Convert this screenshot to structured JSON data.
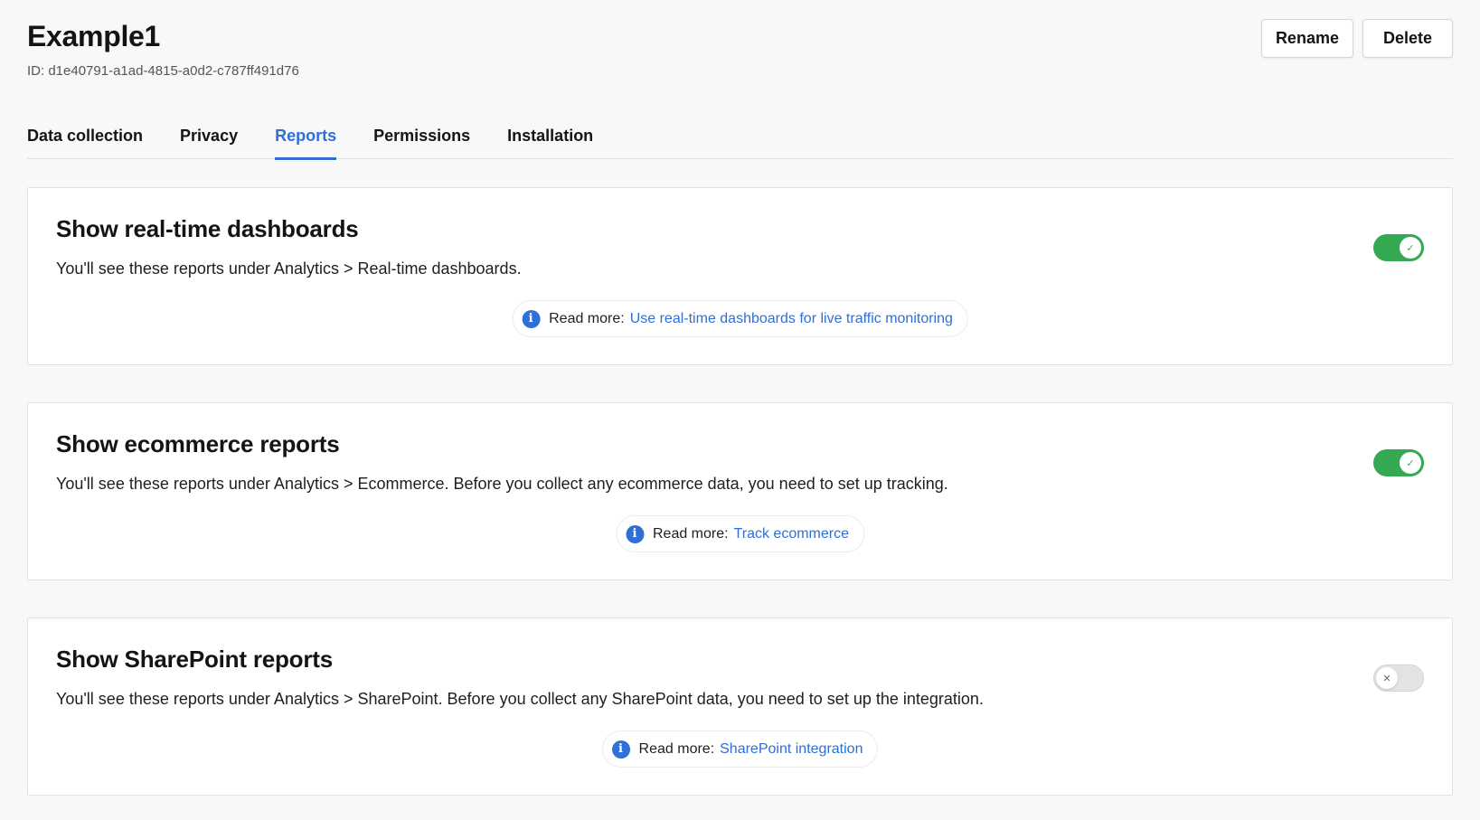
{
  "header": {
    "title": "Example1",
    "id_text": "ID: d1e40791-a1ad-4815-a0d2-c787ff491d76",
    "rename_label": "Rename",
    "delete_label": "Delete"
  },
  "tabs": [
    {
      "label": "Data collection",
      "active": false
    },
    {
      "label": "Privacy",
      "active": false
    },
    {
      "label": "Reports",
      "active": true
    },
    {
      "label": "Permissions",
      "active": false
    },
    {
      "label": "Installation",
      "active": false
    }
  ],
  "cards": [
    {
      "title": "Show real-time dashboards",
      "description": "You'll see these reports under Analytics > Real-time dashboards.",
      "read_more_label": "Read more:",
      "link_text": "Use real-time dashboards for live traffic monitoring",
      "toggle": "on"
    },
    {
      "title": "Show ecommerce reports",
      "description": "You'll see these reports under Analytics > Ecommerce. Before you collect any ecommerce data, you need to set up tracking.",
      "read_more_label": "Read more:",
      "link_text": "Track ecommerce",
      "toggle": "on"
    },
    {
      "title": "Show SharePoint reports",
      "description": "You'll see these reports under Analytics > SharePoint. Before you collect any SharePoint data, you need to set up the integration.",
      "read_more_label": "Read more:",
      "link_text": "SharePoint integration",
      "toggle": "off"
    }
  ],
  "icons": {
    "info": "info-icon",
    "check": "check-icon",
    "close": "close-icon"
  },
  "colors": {
    "accent": "#2f6fd6",
    "toggle_on": "#34a853",
    "toggle_off": "#e3e3e3"
  }
}
